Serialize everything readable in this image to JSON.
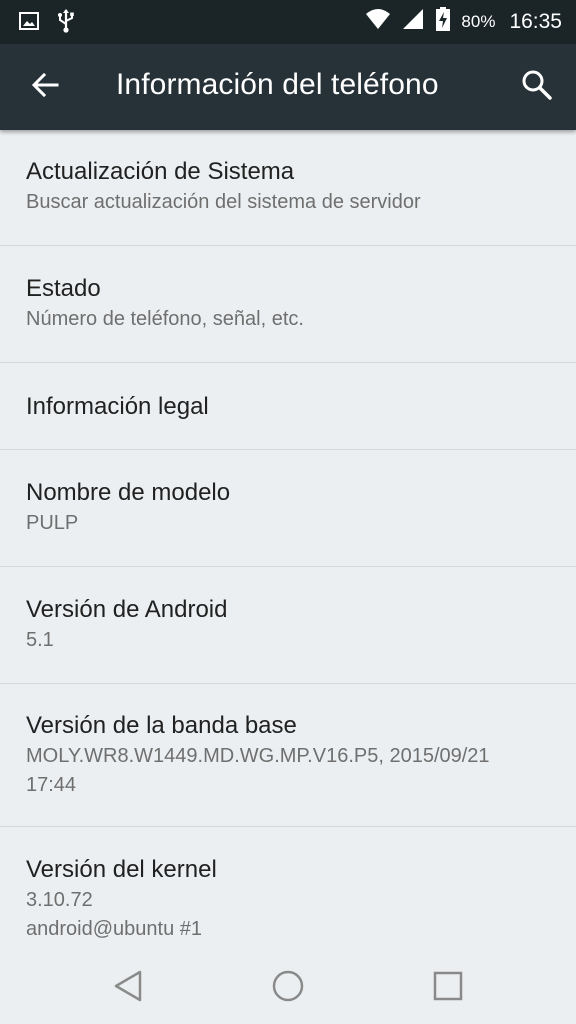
{
  "status_bar": {
    "battery_percent": "80%",
    "time": "16:35",
    "icons": [
      "image-icon",
      "usb-icon",
      "wifi-icon",
      "signal-icon",
      "battery-charging-icon"
    ]
  },
  "app_bar": {
    "title": "Información del teléfono",
    "back_icon": "arrow-back-icon",
    "search_icon": "search-icon"
  },
  "settings_items": [
    {
      "title": "Actualización de Sistema",
      "summary": "Buscar actualización del sistema de servidor"
    },
    {
      "title": "Estado",
      "summary": "Número de teléfono, señal, etc."
    },
    {
      "title": "Información legal",
      "summary": ""
    },
    {
      "title": "Nombre de modelo",
      "summary": "PULP"
    },
    {
      "title": "Versión de Android",
      "summary": "5.1"
    },
    {
      "title": "Versión de la banda base",
      "summary": "MOLY.WR8.W1449.MD.WG.MP.V16.P5, 2015/09/21\n17:44"
    },
    {
      "title": "Versión del kernel",
      "summary": "3.10.72\nandroid@ubuntu #1"
    }
  ],
  "nav_bar": {
    "buttons": [
      "back-triangle-icon",
      "home-circle-icon",
      "recents-square-icon"
    ]
  },
  "colors": {
    "status_bar": "#1b2528",
    "app_bar": "#263238",
    "background": "#eceff1",
    "title_text": "#212121",
    "summary_text": "#6f6f6f"
  }
}
